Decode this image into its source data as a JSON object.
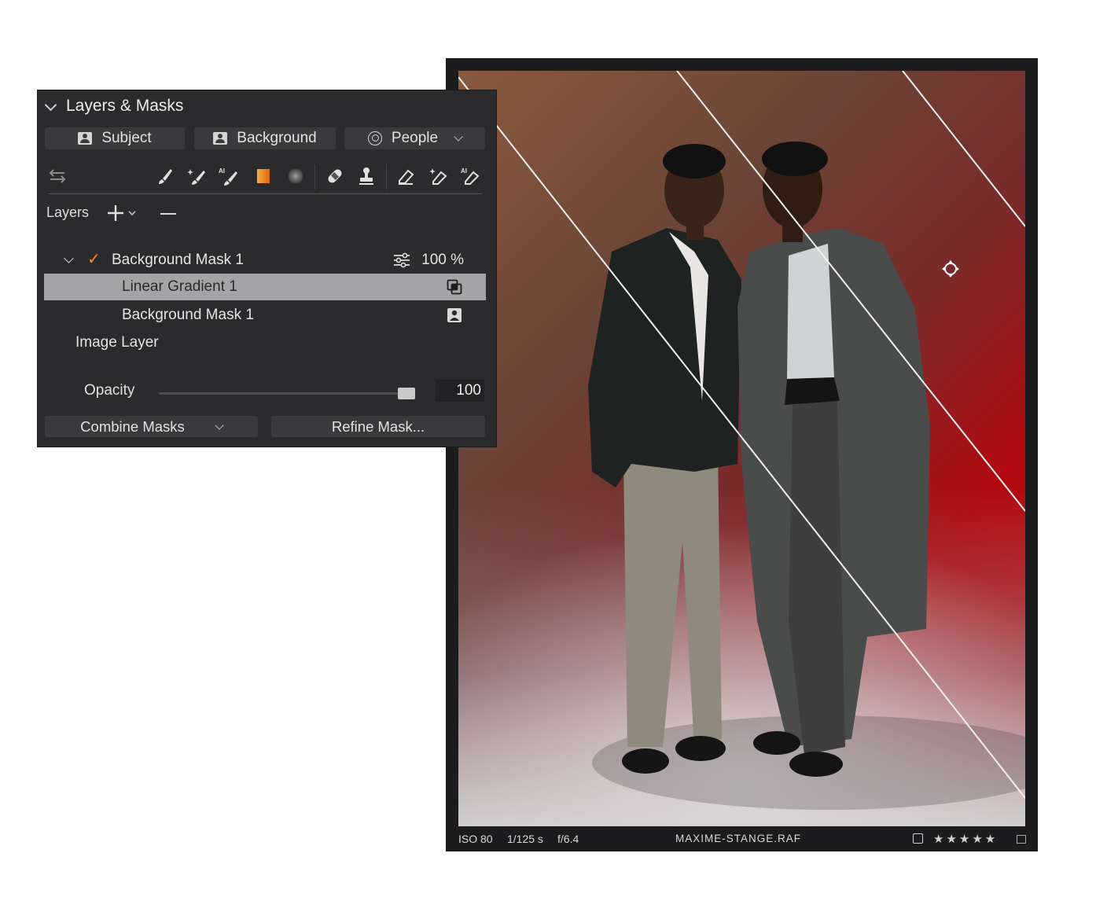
{
  "panel": {
    "title": "Layers & Masks",
    "presets": {
      "subject": "Subject",
      "background": "Background",
      "people": "People"
    },
    "tools": [
      "adjustments-icon",
      "brush-icon",
      "magic-brush-icon",
      "ai-brush-icon",
      "linear-gradient-icon",
      "radial-gradient-icon",
      "heal-icon",
      "clone-stamp-icon",
      "eraser-icon",
      "magic-eraser-icon",
      "ai-eraser-icon"
    ],
    "layers_label": "Layers",
    "tree": {
      "mask_group": "Background Mask 1",
      "mask_opacity": "100 %",
      "gradient_item": "Linear Gradient 1",
      "bg_mask_item": "Background Mask 1",
      "image_layer": "Image Layer"
    },
    "opacity": {
      "label": "Opacity",
      "value": "100",
      "slider_fraction": 1.0
    },
    "buttons": {
      "combine": "Combine Masks",
      "refine": "Refine Mask..."
    },
    "accent_color": "#ff8c1a",
    "selected_row_color": "#a4a4a6"
  },
  "viewer": {
    "iso": "ISO 80",
    "shutter": "1/125 s",
    "aperture": "f/6.4",
    "filename": "MAXIME-STANGE.RAF",
    "stars": "★★★★★",
    "rating": 5
  }
}
